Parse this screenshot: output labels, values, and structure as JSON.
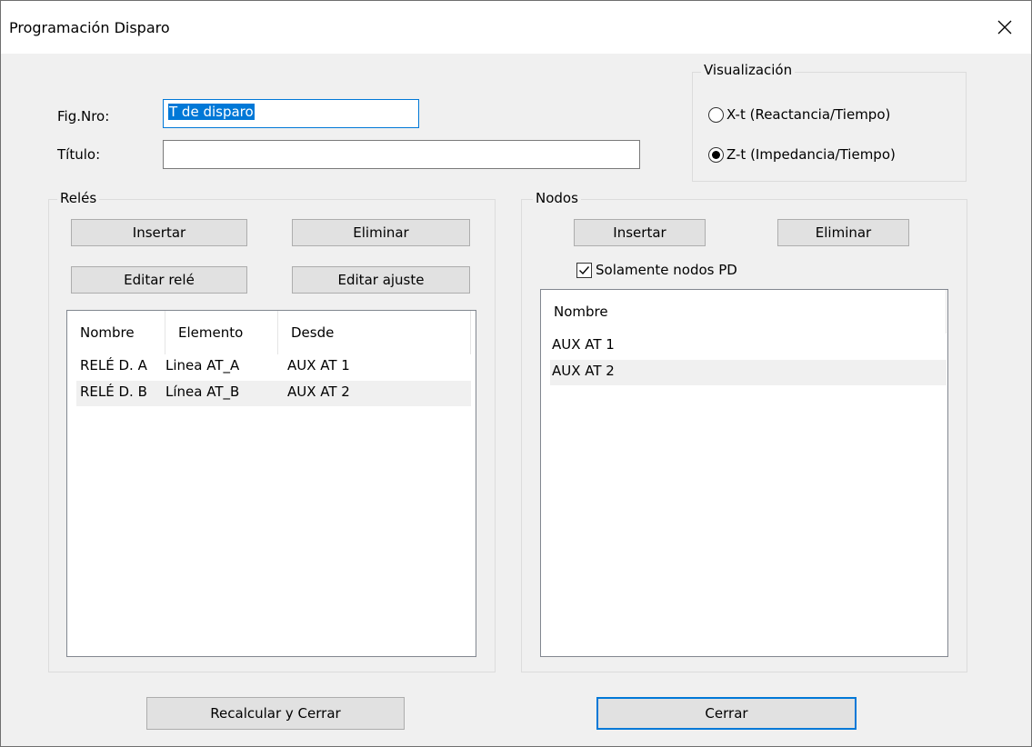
{
  "window": {
    "title": "Programación Disparo"
  },
  "form": {
    "fig_label": "Fig.Nro:",
    "fig_value": "T de disparo",
    "titulo_label": "Título:",
    "titulo_value": ""
  },
  "visualizacion": {
    "legend": "Visualización",
    "options": [
      {
        "label": "X-t (Reactancia/Tiempo)",
        "selected": false
      },
      {
        "label": "Z-t (Impedancia/Tiempo)",
        "selected": true
      }
    ]
  },
  "reles": {
    "legend": "Relés",
    "buttons": {
      "insertar": "Insertar",
      "eliminar": "Eliminar",
      "editar_rele": "Editar relé",
      "editar_ajuste": "Editar ajuste"
    },
    "columns": [
      "Nombre",
      "Elemento",
      "Desde"
    ],
    "rows": [
      [
        "RELÉ D. A",
        "Linea AT_A",
        "AUX AT 1"
      ],
      [
        "RELÉ D. B",
        "Línea AT_B",
        "AUX AT 2"
      ]
    ]
  },
  "nodos": {
    "legend": "Nodos",
    "buttons": {
      "insertar": "Insertar",
      "eliminar": "Eliminar"
    },
    "checkbox_label": "Solamente nodos PD",
    "checkbox_checked": true,
    "columns": [
      "Nombre"
    ],
    "rows": [
      "AUX AT 1",
      "AUX AT 2"
    ]
  },
  "footer": {
    "recalcular": "Recalcular y Cerrar",
    "cerrar": "Cerrar"
  }
}
